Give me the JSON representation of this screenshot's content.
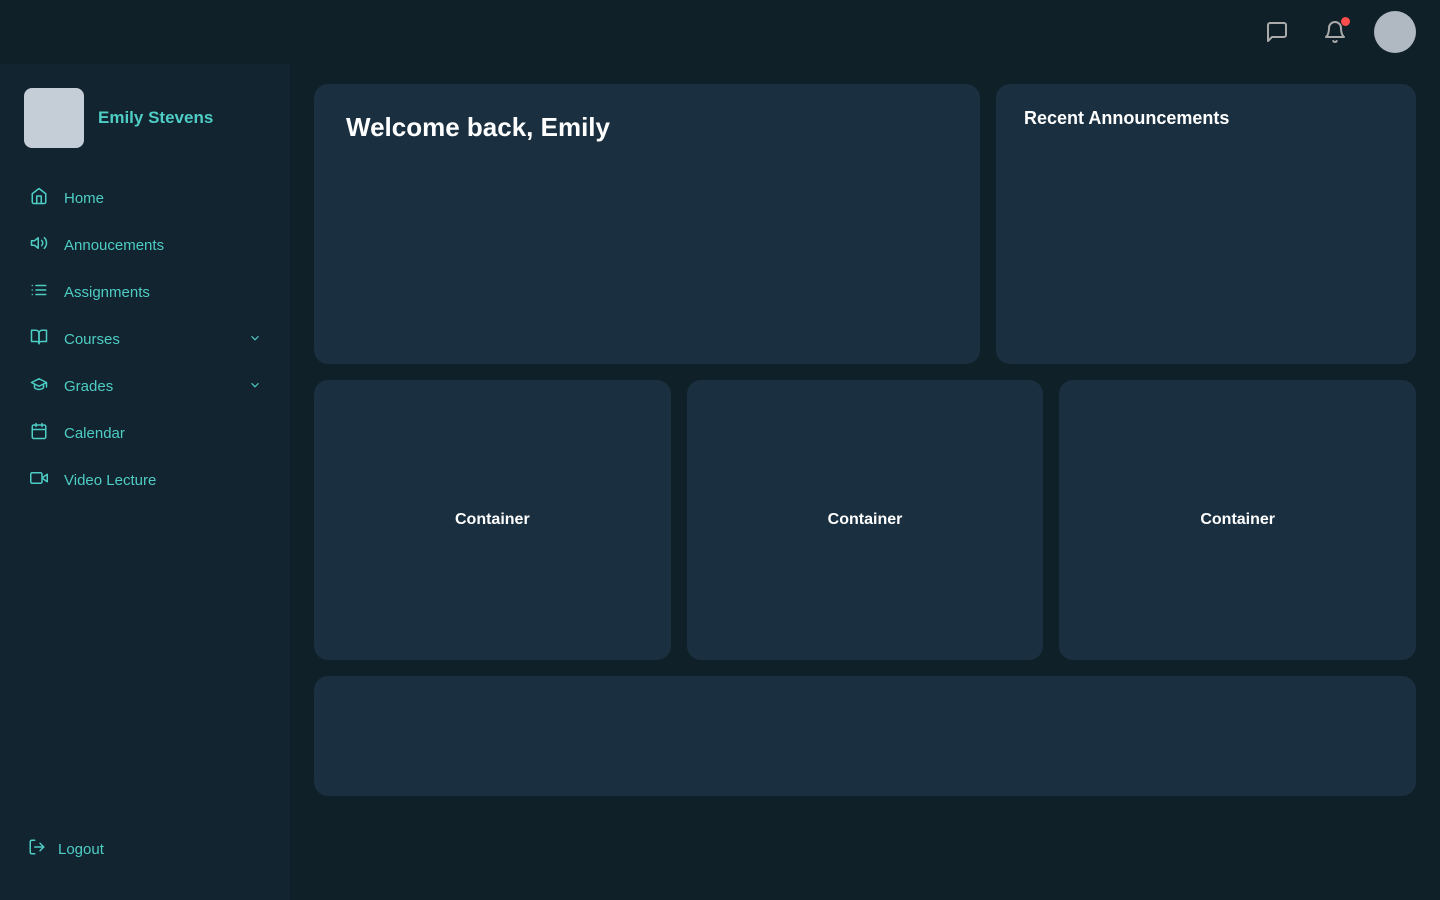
{
  "topbar": {
    "chat_icon": "💬",
    "bell_icon": "🔔",
    "has_notification": true
  },
  "sidebar": {
    "user": {
      "name": "Emily Stevens"
    },
    "nav_items": [
      {
        "id": "home",
        "label": "Home",
        "icon": "⌂"
      },
      {
        "id": "announcements",
        "label": "Annoucements",
        "icon": "📢"
      },
      {
        "id": "assignments",
        "label": "Assignments",
        "icon": "✅"
      },
      {
        "id": "courses",
        "label": "Courses",
        "icon": "📖",
        "has_chevron": true
      },
      {
        "id": "grades",
        "label": "Grades",
        "icon": "🎓",
        "has_chevron": true
      },
      {
        "id": "calendar",
        "label": "Calendar",
        "icon": "📅"
      },
      {
        "id": "video-lecture",
        "label": "Video Lecture",
        "icon": "🎬"
      }
    ],
    "logout": {
      "label": "Logout",
      "icon": "↪"
    }
  },
  "main": {
    "welcome_title": "Welcome back, Emily",
    "announcements_title": "Recent Announcements",
    "containers": [
      {
        "label": "Container"
      },
      {
        "label": "Container"
      },
      {
        "label": "Container"
      }
    ]
  }
}
